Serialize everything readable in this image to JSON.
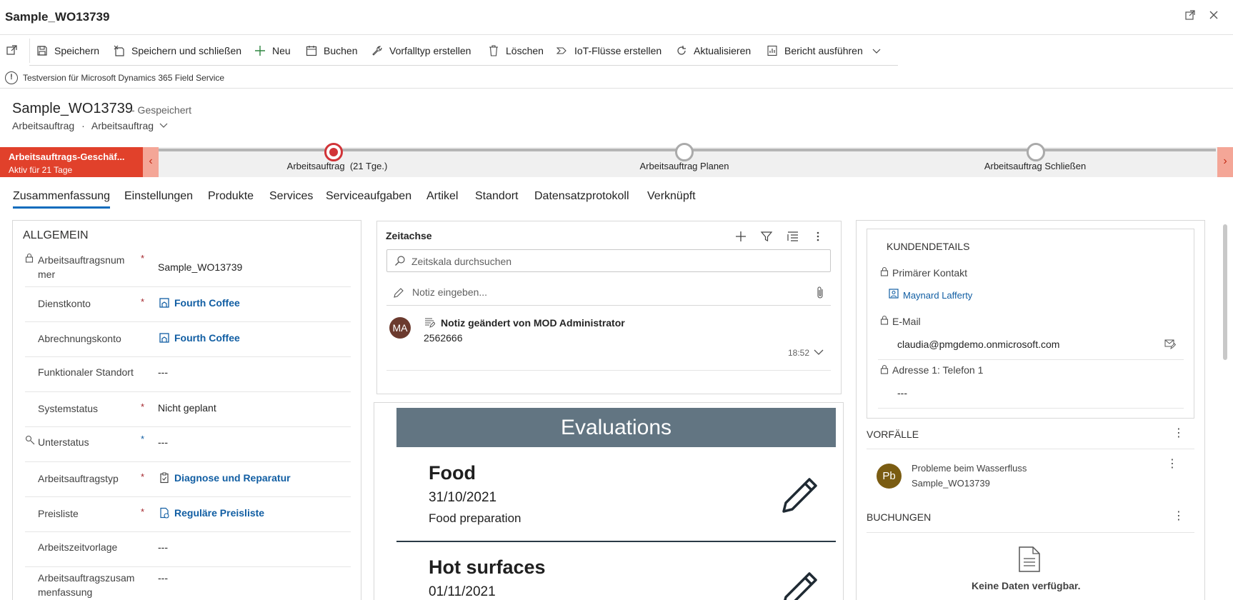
{
  "window": {
    "title": "Sample_WO13739"
  },
  "commands": {
    "save": "Speichern",
    "save_close": "Speichern und schließen",
    "new": "Neu",
    "book": "Buchen",
    "incident_type": "Vorfalltyp erstellen",
    "delete": "Löschen",
    "iot_flows": "IoT-Flüsse erstellen",
    "refresh": "Aktualisieren",
    "run_report": "Bericht ausführen"
  },
  "notice": {
    "text": "Testversion für Microsoft Dynamics 365 Field Service"
  },
  "record": {
    "name": "Sample_WO13739",
    "status": "- Gespeichert",
    "entity": "Arbeitsauftrag",
    "separator": "·",
    "form": "Arbeitsauftrag"
  },
  "process": {
    "active_name": "Arbeitsauftrags-Geschäf...",
    "active_duration": "Aktiv für 21 Tage",
    "stages": [
      {
        "label": "Arbeitsauftrag",
        "duration": "(21 Tge.)"
      },
      {
        "label": "Arbeitsauftrag Planen"
      },
      {
        "label": "Arbeitsauftrag Schließen"
      }
    ]
  },
  "tabs": [
    "Zusammenfassung",
    "Einstellungen",
    "Produkte",
    "Services",
    "Serviceaufgaben",
    "Artikel",
    "Standort",
    "Datensatzprotokoll",
    "Verknüpft"
  ],
  "general": {
    "title": "ALLGEMEIN",
    "fields": [
      {
        "label": "Arbeitsauftragsnum mer",
        "required": "*",
        "value": "Sample_WO13739"
      },
      {
        "label": "Dienstkonto",
        "required": "*",
        "value": "Fourth Coffee"
      },
      {
        "label": "Abrechnungskonto",
        "value": "Fourth Coffee"
      },
      {
        "label": "Funktionaler Standort",
        "value": "---"
      },
      {
        "label": "Systemstatus",
        "required": "*",
        "value": "Nicht geplant"
      },
      {
        "label": "Unterstatus",
        "required": "*",
        "value": "---"
      },
      {
        "label": "Arbeitsauftragstyp",
        "required": "*",
        "value": "Diagnose und Reparatur"
      },
      {
        "label": "Preisliste",
        "required": "*",
        "value": "Reguläre Preisliste"
      },
      {
        "label": "Arbeitszeitvorlage",
        "value": "---"
      },
      {
        "label": "Arbeitsauftragszusam menfassung",
        "value": "---"
      }
    ]
  },
  "timeline": {
    "title": "Zeitachse",
    "search_placeholder": "Zeitskala durchsuchen",
    "note_placeholder": "Notiz eingeben...",
    "entries": [
      {
        "initials": "MA",
        "title": "Notiz geändert von MOD Administrator",
        "body": "2562666",
        "time": "18:52"
      }
    ]
  },
  "evaluations": {
    "title": "Evaluations",
    "items": [
      {
        "title": "Food",
        "date": "31/10/2021",
        "description": "Food preparation"
      },
      {
        "title": "Hot surfaces",
        "date": "01/11/2021"
      }
    ]
  },
  "customer": {
    "title": "KUNDENDETAILS",
    "primary_contact_label": "Primärer Kontakt",
    "primary_contact": "Maynard Lafferty",
    "email_label": "E-Mail",
    "email": "claudia@pmgdemo.onmicrosoft.com",
    "phone_label": "Adresse 1: Telefon 1",
    "phone": "---"
  },
  "incidents": {
    "title": "VORFÄLLE",
    "items": [
      {
        "initials": "Pb",
        "title": "Probleme beim Wasserfluss",
        "subtitle": "Sample_WO13739"
      }
    ]
  },
  "bookings": {
    "title": "BUCHUNGEN",
    "empty": "Keine Daten verfügbar."
  },
  "colors": {
    "accent": "#0f6cbd",
    "process_active": "#e1412b",
    "eval_header": "#627582",
    "avatar_ma": "#6b3a2e",
    "avatar_pb": "#7a5c12"
  }
}
